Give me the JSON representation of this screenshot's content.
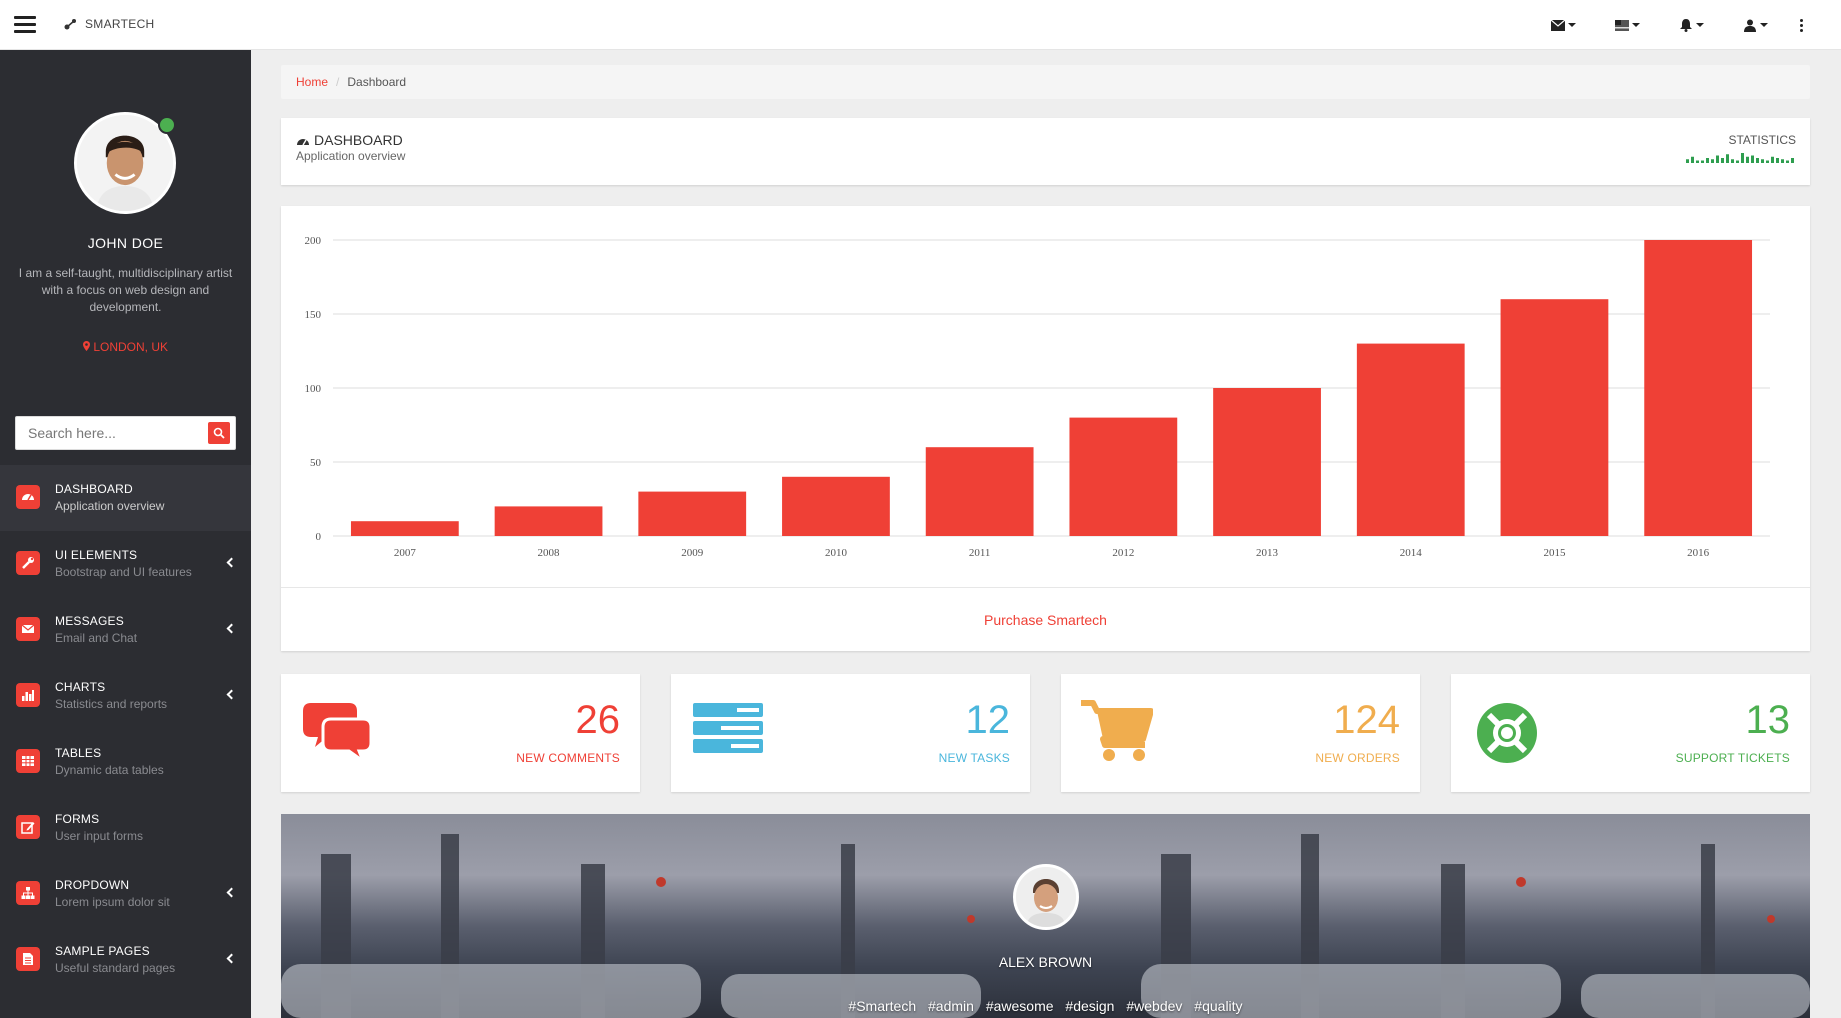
{
  "topbar": {
    "brand": "SMARTECH",
    "icons": [
      "envelope-icon",
      "flag-icon",
      "bell-icon",
      "user-icon",
      "more-vertical-icon"
    ]
  },
  "sidebar": {
    "profile": {
      "name": "JOHN DOE",
      "bio": "I am a self-taught, multidisciplinary artist with a focus on web design and development.",
      "location": "LONDON, UK"
    },
    "search": {
      "placeholder": "Search here..."
    },
    "items": [
      {
        "title": "DASHBOARD",
        "subtitle": "Application overview",
        "icon": "dashboard-icon",
        "active": true,
        "expandable": false
      },
      {
        "title": "UI ELEMENTS",
        "subtitle": "Bootstrap and UI features",
        "icon": "wrench-icon",
        "active": false,
        "expandable": true
      },
      {
        "title": "MESSAGES",
        "subtitle": "Email and Chat",
        "icon": "envelope-icon",
        "active": false,
        "expandable": true
      },
      {
        "title": "CHARTS",
        "subtitle": "Statistics and reports",
        "icon": "bar-chart-icon",
        "active": false,
        "expandable": true
      },
      {
        "title": "TABLES",
        "subtitle": "Dynamic data tables",
        "icon": "table-icon",
        "active": false,
        "expandable": false
      },
      {
        "title": "FORMS",
        "subtitle": "User input forms",
        "icon": "edit-icon",
        "active": false,
        "expandable": false
      },
      {
        "title": "DROPDOWN",
        "subtitle": "Lorem ipsum dolor sit",
        "icon": "sitemap-icon",
        "active": false,
        "expandable": true
      },
      {
        "title": "SAMPLE PAGES",
        "subtitle": "Useful standard pages",
        "icon": "file-icon",
        "active": false,
        "expandable": true
      }
    ]
  },
  "breadcrumb": {
    "home": "Home",
    "current": "Dashboard"
  },
  "page_header": {
    "title": "DASHBOARD",
    "subtitle": "Application overview",
    "stat_label": "STATISTICS",
    "sparkline": [
      3,
      5,
      2,
      2,
      4,
      3,
      6,
      4,
      7,
      3,
      2,
      8,
      5,
      6,
      4,
      3,
      2,
      5,
      4,
      3,
      2,
      4
    ]
  },
  "chart_data": {
    "type": "bar",
    "categories": [
      "2007",
      "2008",
      "2009",
      "2010",
      "2011",
      "2012",
      "2013",
      "2014",
      "2015",
      "2016"
    ],
    "values": [
      10,
      20,
      30,
      40,
      60,
      80,
      100,
      130,
      160,
      200
    ],
    "yticks": [
      0,
      50,
      100,
      150,
      200
    ],
    "ylim": [
      0,
      200
    ],
    "grid": true,
    "color": "#ef4036"
  },
  "chart_footer": {
    "link": "Purchase Smartech"
  },
  "stats": [
    {
      "value": "26",
      "label": "NEW COMMENTS",
      "icon": "comments-icon",
      "color": "#ef4036"
    },
    {
      "value": "12",
      "label": "NEW TASKS",
      "icon": "tasks-icon",
      "color": "#4ab6dc"
    },
    {
      "value": "124",
      "label": "NEW ORDERS",
      "icon": "cart-icon",
      "color": "#f0ad4e"
    },
    {
      "value": "13",
      "label": "SUPPORT TICKETS",
      "icon": "lifebuoy-icon",
      "color": "#4caf50"
    }
  ],
  "hero": {
    "name": "ALEX BROWN",
    "tags": [
      "#Smartech",
      "#admin",
      "#awesome",
      "#design",
      "#webdev",
      "#quality"
    ]
  },
  "colors": {
    "accent": "#ef4036",
    "sidebar_bg": "#2c2d32"
  }
}
